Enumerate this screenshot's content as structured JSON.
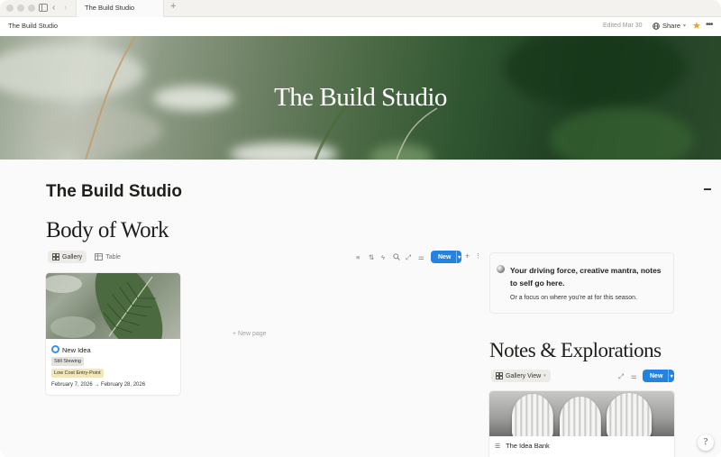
{
  "window": {
    "tab_title": "The Build Studio",
    "new_tab_icon": "+"
  },
  "topbar": {
    "breadcrumb": "The Build Studio",
    "edited": "Edited Mar 30",
    "share_label": "Share",
    "share_icon": "globe-icon",
    "favorite_icon": "star-icon",
    "more_icon": "ellipsis-icon",
    "favorite_color": "#e6a817"
  },
  "cover": {
    "title": "The Build Studio"
  },
  "page": {
    "title": "The Build Studio"
  },
  "body_of_work": {
    "heading": "Body of Work",
    "views": [
      {
        "label": "Gallery",
        "icon": "gallery-icon",
        "active": true
      },
      {
        "label": "Table",
        "icon": "table-icon",
        "active": false
      }
    ],
    "new_label": "New",
    "new_page_label": "New page",
    "cards": [
      {
        "title": "New Idea",
        "tags": [
          "Still Stewing",
          "Low Cost Entry-Point"
        ],
        "dates": "February 7, 2026 → February 28, 2026"
      }
    ]
  },
  "callout": {
    "heading": "Your driving force, creative mantra, notes to self go here.",
    "sub": "Or a focus on where you're at for this season."
  },
  "notes": {
    "heading": "Notes & Explorations",
    "view_label": "Gallery View",
    "new_label": "New",
    "cards": [
      {
        "title": "The Idea Bank"
      }
    ]
  },
  "accent_color": "#2383e2",
  "help_label": "?"
}
